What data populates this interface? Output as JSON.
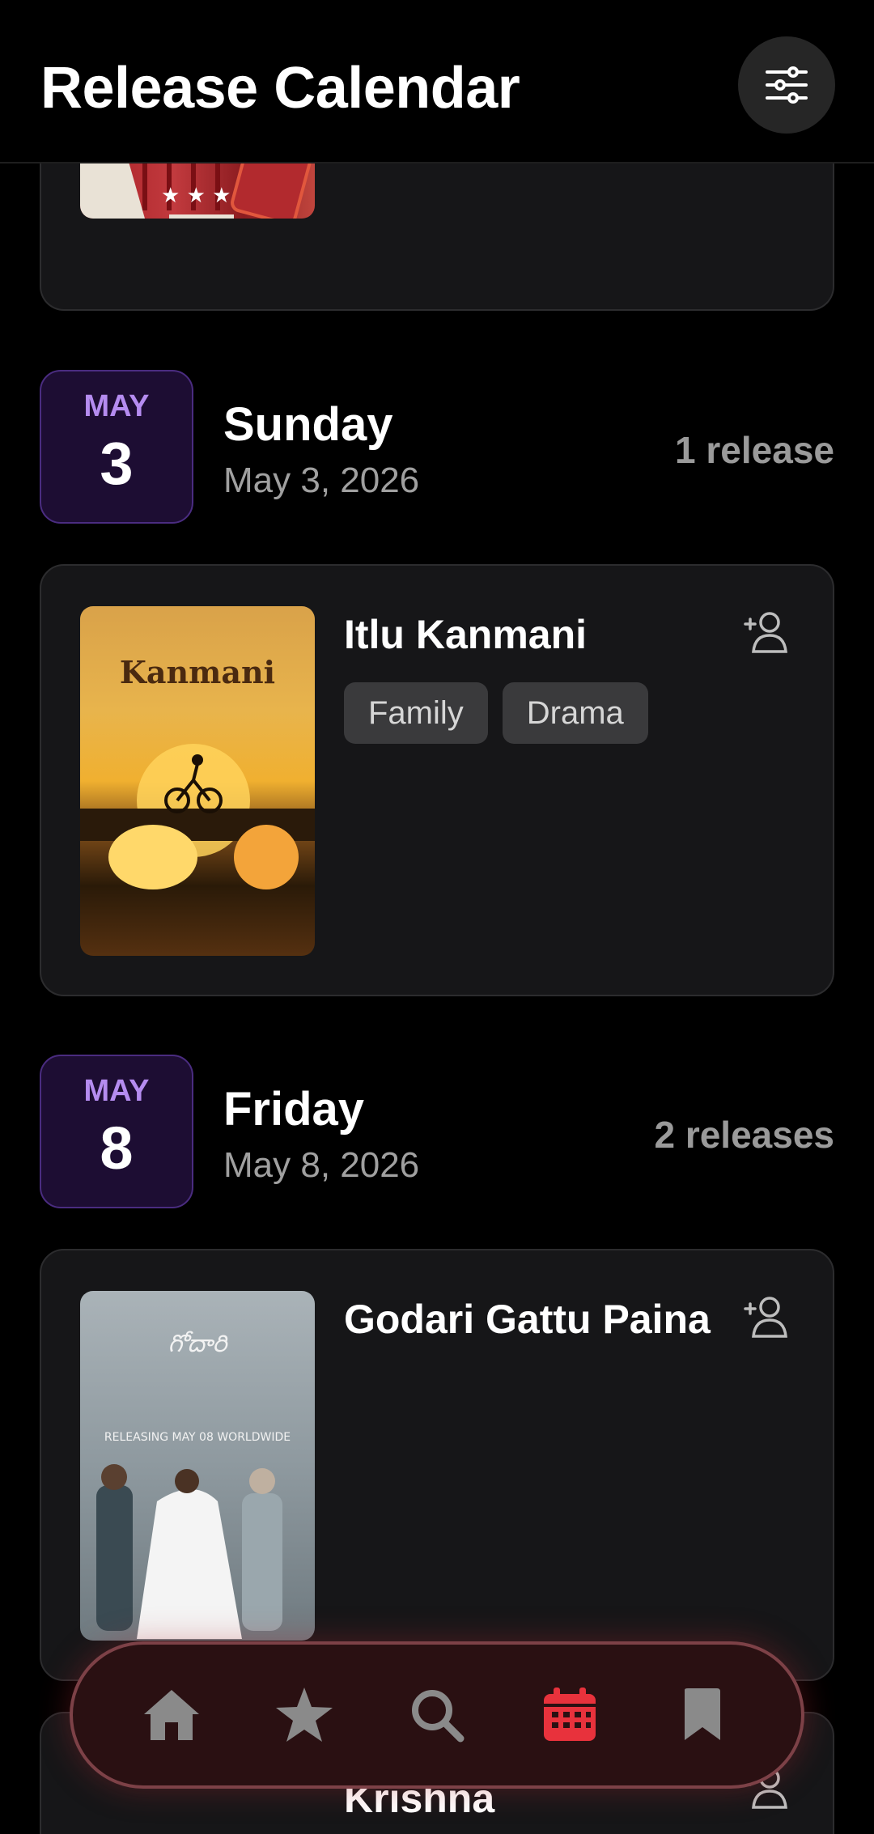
{
  "header": {
    "title": "Release Calendar",
    "filter_icon": "sliders-icon"
  },
  "groups": [
    {
      "month": "MAY",
      "day": "3",
      "weekday": "Sunday",
      "full_date": "May 3, 2026",
      "count": "1 release",
      "movies": [
        {
          "title": "Itlu Kanmani",
          "tags": [
            "Family",
            "Drama"
          ],
          "poster_text": "Kanmani"
        }
      ]
    },
    {
      "month": "MAY",
      "day": "8",
      "weekday": "Friday",
      "full_date": "May 8, 2026",
      "count": "2 releases",
      "movies": [
        {
          "title": "Godari Gattu Paina",
          "tags": [],
          "poster_text": "RELEASING MAY 08 WORLDWIDE"
        },
        {
          "title": "Krishna",
          "tags": []
        }
      ]
    }
  ],
  "nav": {
    "items": [
      {
        "icon": "home-icon",
        "active": false
      },
      {
        "icon": "star-icon",
        "active": false
      },
      {
        "icon": "search-icon",
        "active": false
      },
      {
        "icon": "calendar-icon",
        "active": true
      },
      {
        "icon": "bookmark-icon",
        "active": false
      }
    ],
    "active_color": "#e8323c",
    "inactive_color": "#8a8a8a"
  }
}
